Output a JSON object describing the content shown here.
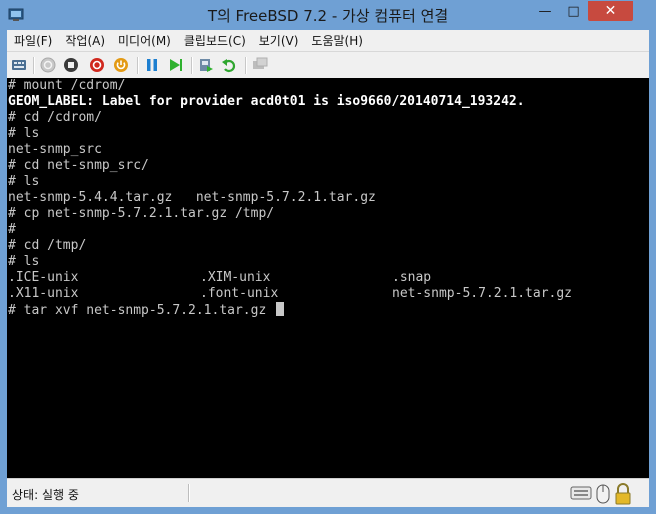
{
  "window": {
    "title": "T의 FreeBSD 7.2 - 가상 컴퓨터 연결",
    "minimize_glyph": "—",
    "maximize_glyph": "□",
    "close_glyph": "✕"
  },
  "menu": {
    "items": [
      {
        "label": "파일(F)"
      },
      {
        "label": "작업(A)"
      },
      {
        "label": "미디어(M)"
      },
      {
        "label": "클립보드(C)"
      },
      {
        "label": "보기(V)"
      },
      {
        "label": "도움말(H)"
      }
    ]
  },
  "toolbar": {
    "icons": [
      "ctrl-alt-del-icon",
      "start-icon",
      "turn-off-icon",
      "shut-down-icon",
      "power-icon",
      "pause-icon",
      "resume-icon",
      "checkpoint-icon",
      "revert-icon",
      "enhanced-session-icon"
    ]
  },
  "console": {
    "lines": [
      {
        "text": "# mount /cdrom/",
        "bright": false
      },
      {
        "text": "GEOM_LABEL: Label for provider acd0t01 is iso9660/20140714_193242.",
        "bright": true
      },
      {
        "text": "# cd /cdrom/",
        "bright": false
      },
      {
        "text": "# ls",
        "bright": false
      },
      {
        "text": "net-snmp_src",
        "bright": false
      },
      {
        "text": "# cd net-snmp_src/",
        "bright": false
      },
      {
        "text": "# ls",
        "bright": false
      },
      {
        "text": "net-snmp-5.4.4.tar.gz   net-snmp-5.7.2.1.tar.gz",
        "bright": false
      },
      {
        "text": "# cp net-snmp-5.7.2.1.tar.gz /tmp/",
        "bright": false
      },
      {
        "text": "#",
        "bright": false
      },
      {
        "text": "# cd /tmp/",
        "bright": false
      },
      {
        "text": "# ls",
        "bright": false
      }
    ],
    "listing": [
      [
        ".ICE-unix",
        ".XIM-unix",
        ".snap"
      ],
      [
        ".X11-unix",
        ".font-unix",
        "net-snmp-5.7.2.1.tar.gz"
      ]
    ],
    "prompt": "# tar xvf net-snmp-5.7.2.1.tar.gz "
  },
  "statusbar": {
    "status": "상태: 실행 중"
  }
}
